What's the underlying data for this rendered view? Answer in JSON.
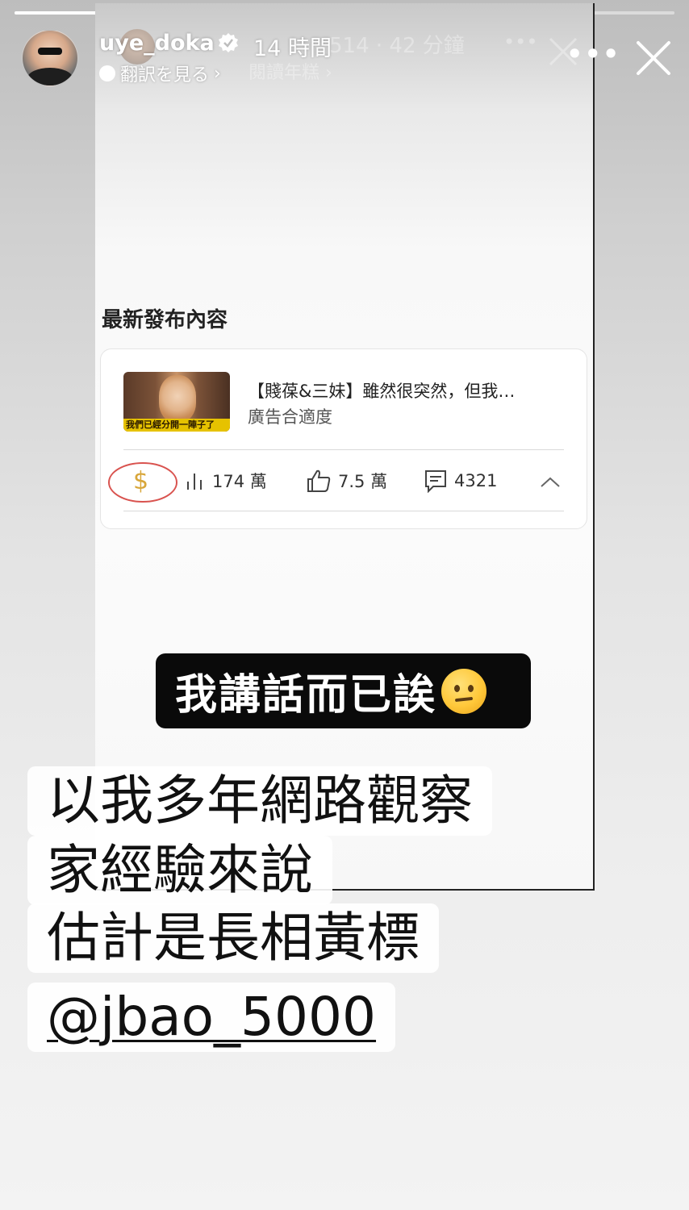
{
  "story": {
    "progress": [
      0.48,
      0.0
    ],
    "username": "uye_doka",
    "time_ago": "14 時間",
    "translate_label": "翻訳を見る",
    "translate_chevron": "›",
    "more_label": "•••"
  },
  "embedded": {
    "ghost_time": "514 · 42 分鐘",
    "ghost_sub": "閱讀年糕 ›",
    "ghost_dots": "•••",
    "section_title": "最新發布內容",
    "video": {
      "title": "【賤葆&三妹】雖然很突然，但我…",
      "subtitle": "廣告合適度",
      "thumb_caption": "我們已經分開一陣子了",
      "views": "174 萬",
      "likes": "7.5 萬",
      "comments": "4321",
      "dollar_symbol": "$"
    }
  },
  "sticker": {
    "text": "我講話而已誒"
  },
  "caption": {
    "lines": [
      "以我多年網路觀察",
      "家經驗來說",
      "估計是長相黃標"
    ],
    "mention": "@jbao_5000"
  },
  "colors": {
    "accent_red_circle": "#d9534f",
    "dollar_gold": "#d8a63a"
  }
}
